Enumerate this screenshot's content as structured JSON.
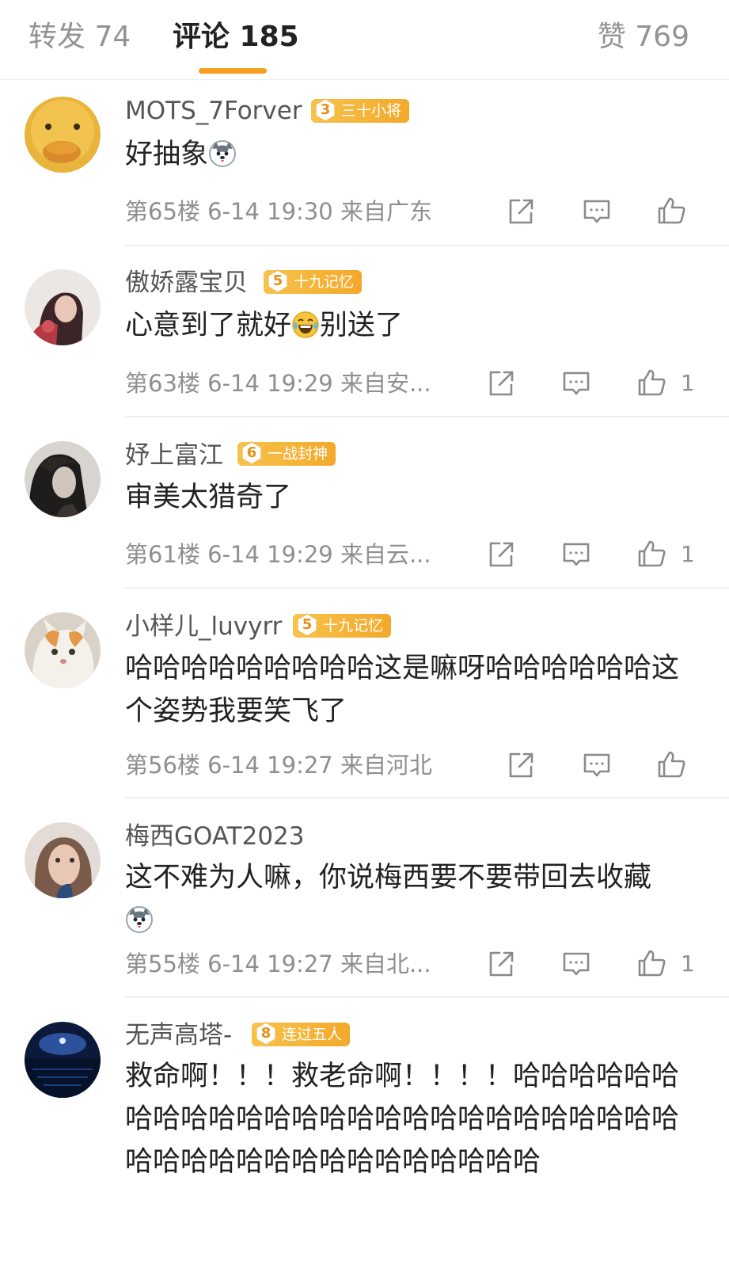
{
  "tabs": {
    "forward": "转发 74",
    "comments": "评论 185",
    "likes": "赞 769"
  },
  "comments": [
    {
      "username": "MOTS_7Forver",
      "level": "3",
      "badge_title": "三十小将",
      "text": "好抽象",
      "floor": "第65楼",
      "time": "6-14 19:30",
      "location": "来自广东",
      "like_count": ""
    },
    {
      "username": "傲娇露宝贝",
      "level": "5",
      "badge_title": "十九记忆",
      "text_before": "心意到了就好",
      "text_after": "别送了",
      "floor": "第63楼",
      "time": "6-14 19:29",
      "location": "来自安...",
      "like_count": "1"
    },
    {
      "username": "妤上富江",
      "level": "6",
      "badge_title": "一战封神",
      "text": "审美太猎奇了",
      "floor": "第61楼",
      "time": "6-14 19:29",
      "location": "来自云...",
      "like_count": "1"
    },
    {
      "username": "小样儿_luvyrr",
      "level": "5",
      "badge_title": "十九记忆",
      "text": "哈哈哈哈哈哈哈哈哈这是嘛呀哈哈哈哈哈哈这个姿势我要笑飞了",
      "floor": "第56楼",
      "time": "6-14 19:27",
      "location": "来自河北",
      "like_count": ""
    },
    {
      "username": "梅西GOAT2023",
      "text": "这不难为人嘛，你说梅西要不要带回去收藏",
      "floor": "第55楼",
      "time": "6-14 19:27",
      "location": "来自北...",
      "like_count": "1"
    },
    {
      "username": "无声高塔-",
      "level": "8",
      "badge_title": "连过五人",
      "text": "救命啊！！！救老命啊！！！！哈哈哈哈哈哈哈哈哈哈哈哈哈哈哈哈哈哈哈哈哈哈哈哈哈哈哈哈哈哈哈哈哈哈哈哈哈哈哈哈哈"
    }
  ],
  "icons": {
    "share": "share-icon",
    "reply": "comment-icon",
    "like": "thumbs-up-icon",
    "emoji": "dog-emoji-icon",
    "laugh": "laugh-cry-emoji-icon"
  },
  "colors": {
    "accent": "#f5a021",
    "badge": "#f3a92c",
    "meta": "#8f8f8f"
  }
}
